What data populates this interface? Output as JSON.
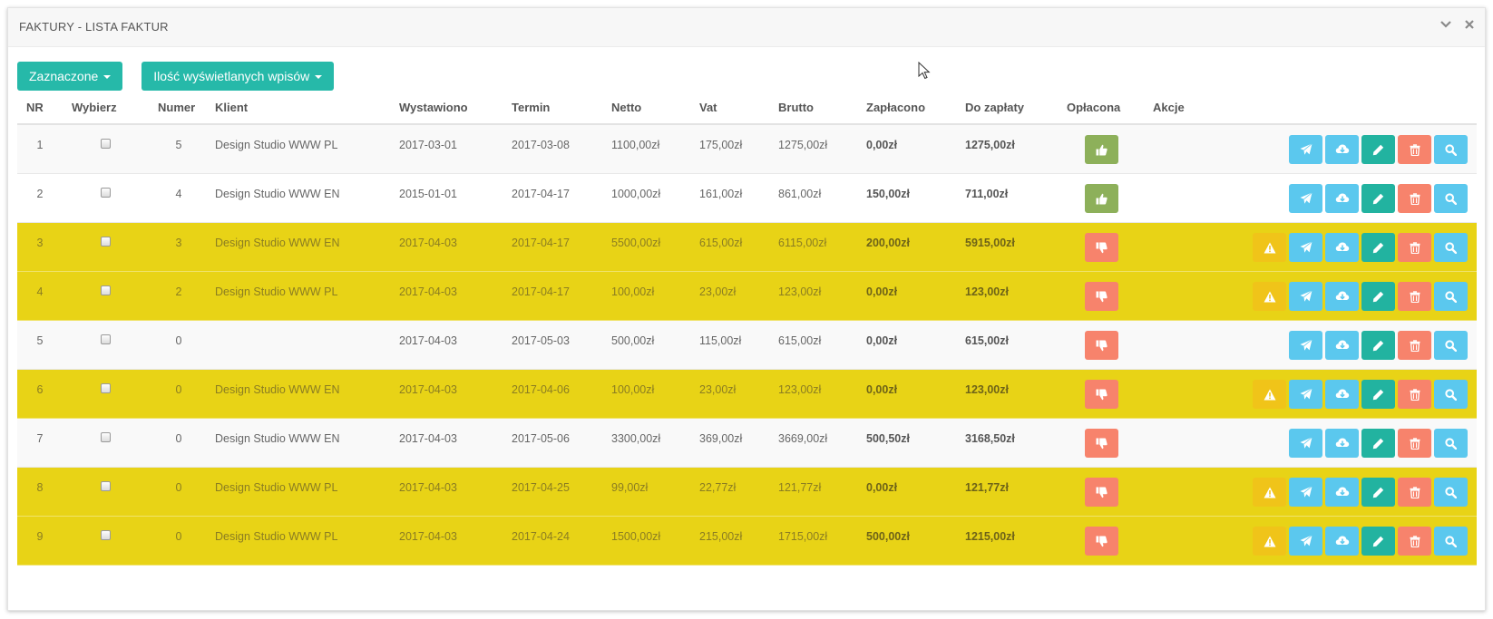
{
  "panel": {
    "title": "FAKTURY - LISTA FAKTUR",
    "header_icons": [
      "chevron-down-icon",
      "close-icon"
    ]
  },
  "toolbar": {
    "selected_label": "Zaznaczone",
    "entries_label": "Ilość wyświetlanych wpisów"
  },
  "columns": {
    "nr": "NR",
    "select": "Wybierz",
    "number": "Numer",
    "client": "Klient",
    "issued": "Wystawiono",
    "due": "Termin",
    "net": "Netto",
    "vat": "Vat",
    "gross": "Brutto",
    "paid_amount": "Zapłacono",
    "to_pay": "Do zapłaty",
    "paid_status": "Opłacona",
    "actions": "Akcje"
  },
  "colors": {
    "teal": "#26b9a9",
    "overdue_row": "#e8d316",
    "paid_yes": "#8db05a",
    "paid_no": "#f7836c",
    "info": "#5bc8ee",
    "warning": "#f0c419"
  },
  "rows": [
    {
      "nr": "1",
      "number": "5",
      "client": "Design Studio WWW PL",
      "issued": "2017-03-01",
      "due": "2017-03-08",
      "net": "1100,00zł",
      "vat": "175,00zł",
      "gross": "1275,00zł",
      "paid": "0,00zł",
      "to_pay": "1275,00zł",
      "is_paid": true,
      "overdue": false,
      "actions": [
        "send-icon",
        "download-icon",
        "edit-icon",
        "delete-icon",
        "view-icon"
      ]
    },
    {
      "nr": "2",
      "number": "4",
      "client": "Design Studio WWW EN",
      "issued": "2015-01-01",
      "due": "2017-04-17",
      "net": "1000,00zł",
      "vat": "161,00zł",
      "gross": "861,00zł",
      "paid": "150,00zł",
      "to_pay": "711,00zł",
      "is_paid": true,
      "overdue": false,
      "actions": [
        "send-icon",
        "download-icon",
        "edit-icon",
        "delete-icon",
        "view-icon"
      ]
    },
    {
      "nr": "3",
      "number": "3",
      "client": "Design Studio WWW EN",
      "issued": "2017-04-03",
      "due": "2017-04-17",
      "net": "5500,00zł",
      "vat": "615,00zł",
      "gross": "6115,00zł",
      "paid": "200,00zł",
      "to_pay": "5915,00zł",
      "is_paid": false,
      "overdue": true,
      "actions": [
        "warning-icon",
        "send-icon",
        "download-icon",
        "edit-icon",
        "delete-icon",
        "view-icon"
      ]
    },
    {
      "nr": "4",
      "number": "2",
      "client": "Design Studio WWW PL",
      "issued": "2017-04-03",
      "due": "2017-04-17",
      "net": "100,00zł",
      "vat": "23,00zł",
      "gross": "123,00zł",
      "paid": "0,00zł",
      "to_pay": "123,00zł",
      "is_paid": false,
      "overdue": true,
      "actions": [
        "warning-icon",
        "send-icon",
        "download-icon",
        "edit-icon",
        "delete-icon",
        "view-icon"
      ]
    },
    {
      "nr": "5",
      "number": "0",
      "client": "",
      "issued": "2017-04-03",
      "due": "2017-05-03",
      "net": "500,00zł",
      "vat": "115,00zł",
      "gross": "615,00zł",
      "paid": "0,00zł",
      "to_pay": "615,00zł",
      "is_paid": false,
      "overdue": false,
      "actions": [
        "send-icon",
        "download-icon",
        "edit-icon",
        "delete-icon",
        "view-icon"
      ]
    },
    {
      "nr": "6",
      "number": "0",
      "client": "Design Studio WWW EN",
      "issued": "2017-04-03",
      "due": "2017-04-06",
      "net": "100,00zł",
      "vat": "23,00zł",
      "gross": "123,00zł",
      "paid": "0,00zł",
      "to_pay": "123,00zł",
      "is_paid": false,
      "overdue": true,
      "actions": [
        "warning-icon",
        "send-icon",
        "download-icon",
        "edit-icon",
        "delete-icon",
        "view-icon"
      ]
    },
    {
      "nr": "7",
      "number": "0",
      "client": "Design Studio WWW EN",
      "issued": "2017-04-03",
      "due": "2017-05-06",
      "net": "3300,00zł",
      "vat": "369,00zł",
      "gross": "3669,00zł",
      "paid": "500,50zł",
      "to_pay": "3168,50zł",
      "is_paid": false,
      "overdue": false,
      "actions": [
        "send-icon",
        "download-icon",
        "edit-icon",
        "delete-icon",
        "view-icon"
      ]
    },
    {
      "nr": "8",
      "number": "0",
      "client": "Design Studio WWW PL",
      "issued": "2017-04-03",
      "due": "2017-04-25",
      "net": "99,00zł",
      "vat": "22,77zł",
      "gross": "121,77zł",
      "paid": "0,00zł",
      "to_pay": "121,77zł",
      "is_paid": false,
      "overdue": true,
      "actions": [
        "warning-icon",
        "send-icon",
        "download-icon",
        "edit-icon",
        "delete-icon",
        "view-icon"
      ]
    },
    {
      "nr": "9",
      "number": "0",
      "client": "Design Studio WWW PL",
      "issued": "2017-04-03",
      "due": "2017-04-24",
      "net": "1500,00zł",
      "vat": "215,00zł",
      "gross": "1715,00zł",
      "paid": "500,00zł",
      "to_pay": "1215,00zł",
      "is_paid": false,
      "overdue": true,
      "actions": [
        "warning-icon",
        "send-icon",
        "download-icon",
        "edit-icon",
        "delete-icon",
        "view-icon"
      ]
    }
  ]
}
